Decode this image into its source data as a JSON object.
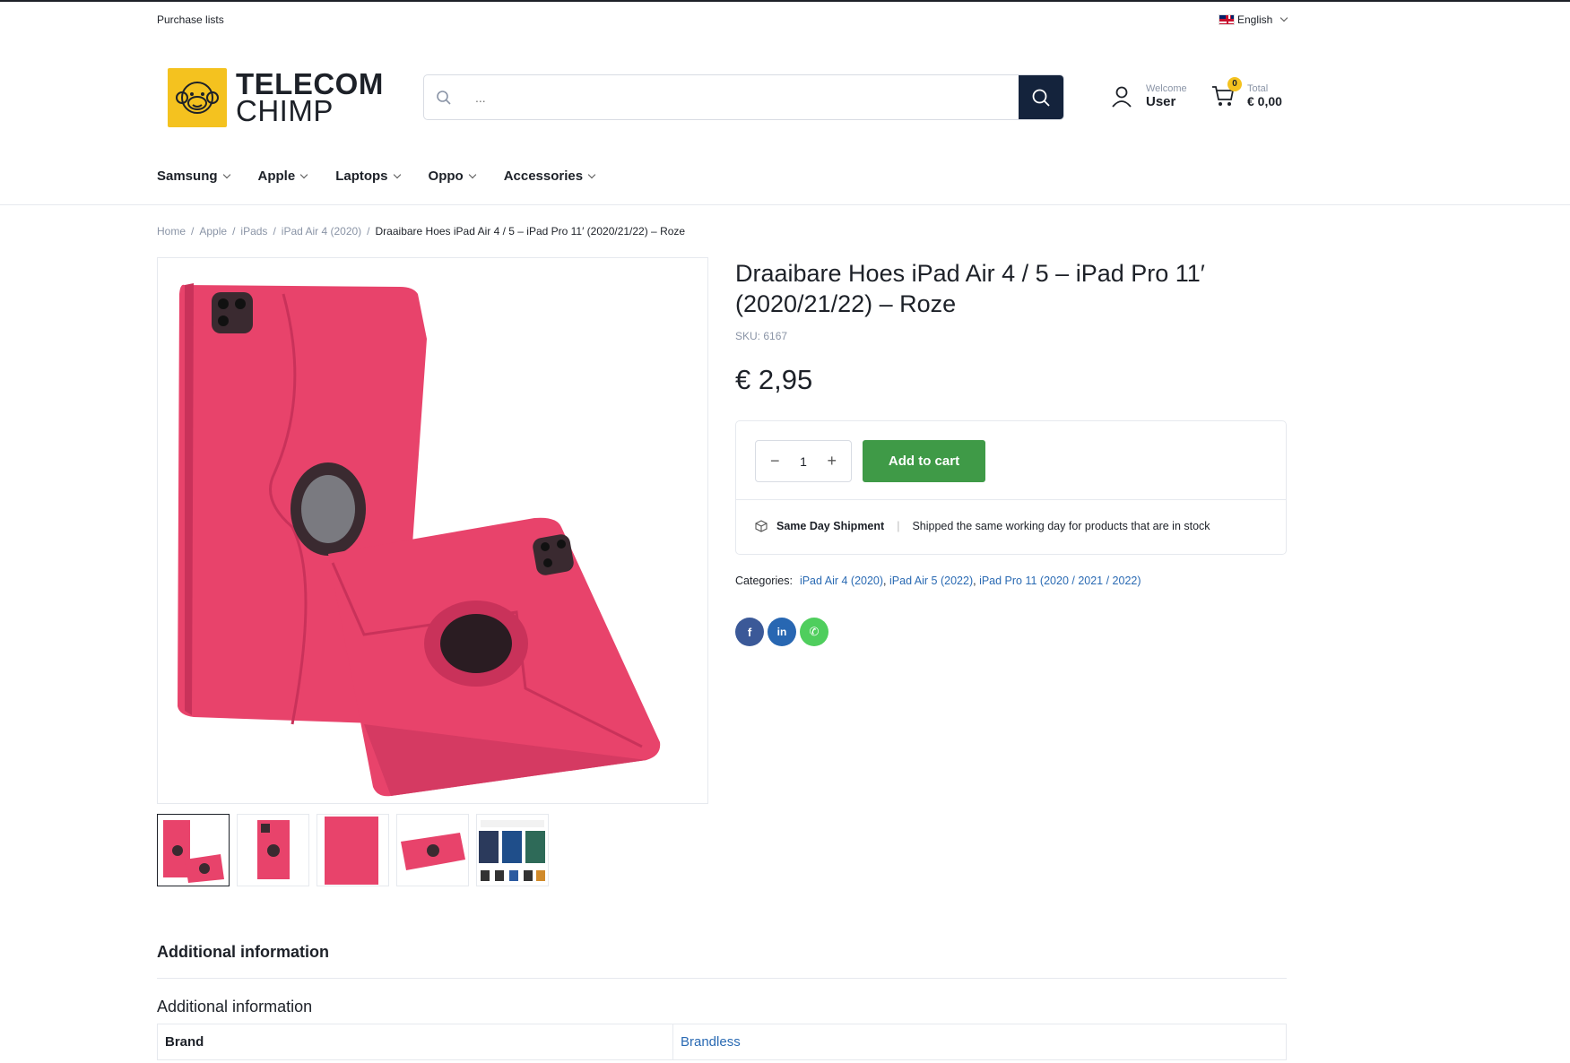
{
  "topbar": {
    "purchase_lists": "Purchase lists",
    "language": "English"
  },
  "brand": {
    "line1": "TELECOM",
    "line2": "CHIMP",
    "color": "#f4c21f"
  },
  "search": {
    "placeholder": "..."
  },
  "account": {
    "welcome": "Welcome",
    "user": "User"
  },
  "cart": {
    "count": "0",
    "total_label": "Total",
    "total_value": "€ 0,00"
  },
  "nav": {
    "items": [
      {
        "label": "Samsung"
      },
      {
        "label": "Apple"
      },
      {
        "label": "Laptops"
      },
      {
        "label": "Oppo"
      },
      {
        "label": "Accessories"
      }
    ]
  },
  "breadcrumb": {
    "items": [
      "Home",
      "Apple",
      "iPads",
      "iPad Air 4 (2020)"
    ],
    "current": "Draaibare Hoes iPad Air 4 / 5 – iPad Pro 11′ (2020/21/22) – Roze"
  },
  "product": {
    "title": "Draaibare Hoes iPad Air 4 / 5 – iPad Pro 11′ (2020/21/22) – Roze",
    "sku": "SKU: 6167",
    "price": "€ 2,95",
    "quantity": "1",
    "add_to_cart": "Add to cart",
    "shipment_title": "Same Day Shipment",
    "shipment_text": "Shipped the same working day for products that are in stock",
    "categories_label": "Categories:",
    "categories": [
      {
        "label": "iPad Air 4 (2020)"
      },
      {
        "label": "iPad Air 5 (2022)"
      },
      {
        "label": "iPad Pro 11 (2020 / 2021 / 2022)"
      }
    ],
    "colors": {
      "case": "#e8436b",
      "button": "#3f9a47",
      "search_button": "#14233c",
      "link": "#2a6ab3"
    }
  },
  "social": [
    {
      "icon": "facebook-icon",
      "glyph": "f",
      "color": "#3b5998"
    },
    {
      "icon": "linkedin-icon",
      "glyph": "in",
      "color": "#2867b2"
    },
    {
      "icon": "whatsapp-icon",
      "glyph": "✆",
      "color": "#4fce5d"
    }
  ],
  "additional": {
    "tab": "Additional information",
    "heading": "Additional information",
    "rows": [
      {
        "label": "Brand",
        "value": "Brandless"
      }
    ]
  }
}
